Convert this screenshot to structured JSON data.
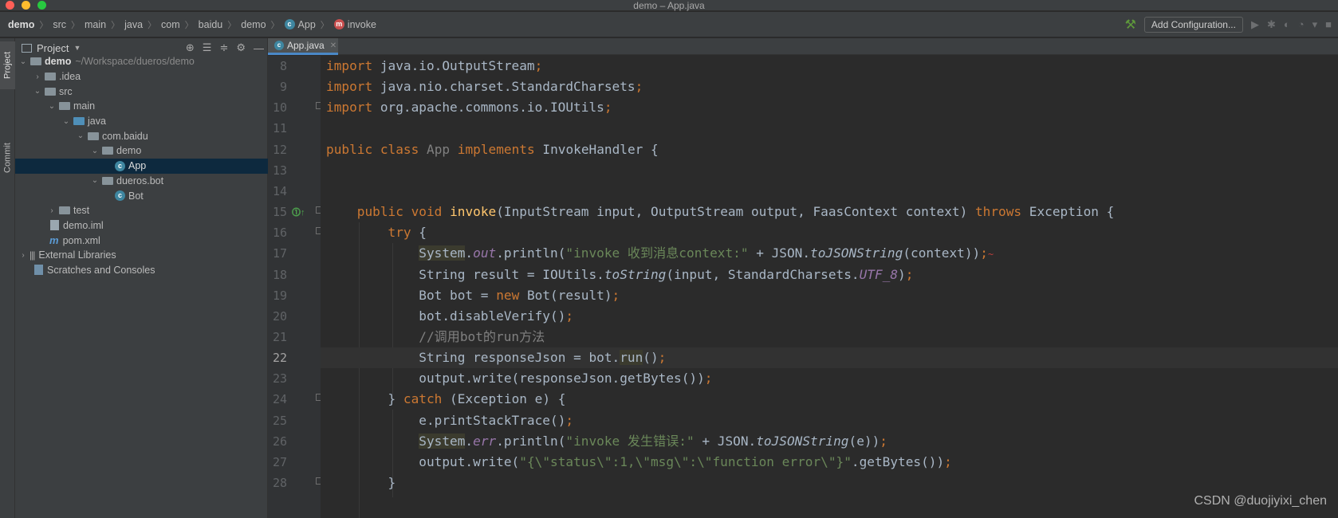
{
  "window": {
    "title": "demo – App.java"
  },
  "breadcrumbs": [
    "demo",
    "src",
    "main",
    "java",
    "com",
    "baidu",
    "demo",
    "App",
    "invoke"
  ],
  "toolbar": {
    "add_config_label": "Add Configuration..."
  },
  "side_tabs": {
    "project": "Project",
    "commit": "Commit"
  },
  "project_panel": {
    "title": "Project",
    "tree": [
      {
        "label": "demo",
        "hint": "~/Workspace/dueros/demo"
      },
      {
        "label": ".idea"
      },
      {
        "label": "src"
      },
      {
        "label": "main"
      },
      {
        "label": "java"
      },
      {
        "label": "com.baidu"
      },
      {
        "label": "demo"
      },
      {
        "label": "App"
      },
      {
        "label": "dueros.bot"
      },
      {
        "label": "Bot"
      },
      {
        "label": "test"
      },
      {
        "label": "demo.iml"
      },
      {
        "label": "pom.xml"
      },
      {
        "label": "External Libraries"
      },
      {
        "label": "Scratches and Consoles"
      }
    ]
  },
  "editor": {
    "tab_label": "App.java",
    "current_line": "22",
    "line_numbers": [
      "8",
      "9",
      "10",
      "11",
      "12",
      "13",
      "14",
      "15",
      "16",
      "17",
      "18",
      "19",
      "20",
      "21",
      "22",
      "23",
      "24",
      "25",
      "26",
      "27",
      "28"
    ],
    "tokens": {
      "import": "import",
      "imp1": " java.io.OutputStream",
      "imp2": " java.nio.charset.StandardCharsets",
      "imp3": " org.apache.commons.io.IOUtils",
      "semi": ";",
      "public": "public",
      "class": "class",
      "app": "App",
      "implements": "implements",
      "invokehandler": " InvokeHandler {",
      "void": "void",
      "invoke": "invoke",
      "sig": "(InputStream input, OutputStream output, FaasContext context) ",
      "throws": "throws",
      "exception": " Exception {",
      "try": "try",
      "brace_open": " {",
      "system": "System",
      "dot": ".",
      "out": "out",
      "println_open": ".println(",
      "str1": "\"invoke 收到消息context:\"",
      "plus_json": " + JSON.",
      "tojsonstring": "toJSONString",
      "ctx_close": "(context))",
      "l18a": "String result = IOUtils.",
      "tostring": "toString",
      "l18b": "(input, StandardCharsets.",
      "utf8": "UTF_8",
      "paren_close": ")",
      "l19a": "Bot bot = ",
      "new": "new",
      "l19b": " Bot(result)",
      "l20": "bot.disableVerify()",
      "comment": "//调用bot的run方法",
      "l22a": "String responseJson = bot.",
      "run": "run",
      "l22b": "()",
      "l23": "output.write(responseJson.getBytes())",
      "brace_close": "} ",
      "catch": "catch",
      "l24b": " (Exception e) {",
      "l25": "e.printStackTrace()",
      "err": "err",
      "str2": "\"invoke 发生错误:\"",
      "e_close": "(e))",
      "l27a": "output.write(",
      "str3": "\"{\\\"status\\\":1,\\\"msg\\\":\\\"function error\\\"}\"",
      "l27b": ".getBytes())",
      "l28": "}"
    }
  },
  "watermark": "CSDN @duojiyixi_chen"
}
